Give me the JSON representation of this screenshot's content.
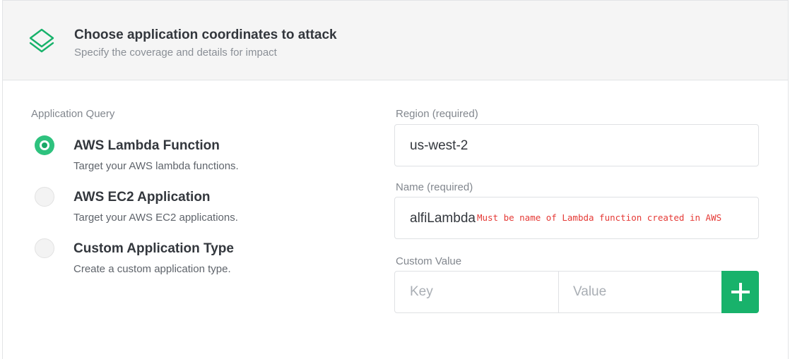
{
  "header": {
    "icon": "layers-icon",
    "title": "Choose application coordinates to attack",
    "subtitle": "Specify the coverage and details for impact"
  },
  "query": {
    "label": "Application Query",
    "options": [
      {
        "title": "AWS Lambda Function",
        "description": "Target your AWS lambda functions.",
        "selected": true
      },
      {
        "title": "AWS EC2 Application",
        "description": "Target your AWS EC2 applications.",
        "selected": false
      },
      {
        "title": "Custom Application Type",
        "description": "Create a custom application type.",
        "selected": false
      }
    ]
  },
  "region": {
    "label": "Region (required)",
    "value": "us-west-2"
  },
  "name": {
    "label": "Name (required)",
    "value": "alfiLambda",
    "warning": "Must be name of Lambda function created in AWS"
  },
  "custom_value": {
    "label": "Custom Value",
    "key_placeholder": "Key",
    "value_placeholder": "Value",
    "add_icon": "plus-icon"
  },
  "colors": {
    "accent": "#18b26b",
    "warning": "#e53935"
  }
}
